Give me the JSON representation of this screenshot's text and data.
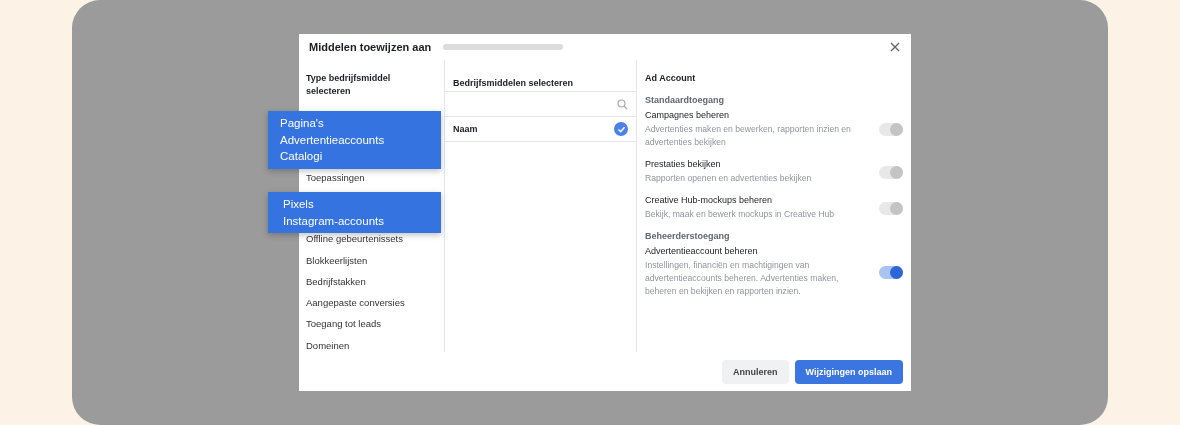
{
  "dialog": {
    "title": "Middelen toewijzen aan",
    "left": {
      "heading": "Type bedrijfsmiddel selecteren",
      "groups": [
        [
          "Toepassingen"
        ],
        [
          "Offline gebeurtenissets",
          "Blokkeerlijsten",
          "Bedrijfstakken",
          "Aangepaste conversies",
          "Toegang tot leads",
          "Domeinen"
        ]
      ]
    },
    "middle": {
      "heading": "Bedrijfsmiddelen selecteren",
      "rows": [
        {
          "label": "Naam",
          "selected": true
        }
      ]
    },
    "right": {
      "heading": "Ad Account",
      "sections": [
        {
          "title": "Standaardtoegang",
          "permissions": [
            {
              "name": "Campagnes beheren",
              "description": "Advertenties maken en bewerken, rapporten inzien en advertenties bekijken",
              "on": true,
              "disabled": true
            },
            {
              "name": "Prestaties bekijken",
              "description": "Rapporten openen en advertenties bekijken",
              "on": true,
              "disabled": true
            },
            {
              "name": "Creative Hub-mockups beheren",
              "description": "Bekijk, maak en bewerk mockups in Creative Hub",
              "on": true,
              "disabled": true
            }
          ]
        },
        {
          "title": "Beheerderstoegang",
          "permissions": [
            {
              "name": "Advertentieaccount beheren",
              "description": "Instellingen, financiën en machtigingen van advertentieaccounts beheren. Advertenties maken, beheren en bekijken en rapporten inzien.",
              "on": true,
              "disabled": false
            }
          ]
        }
      ]
    },
    "buttons": [
      {
        "label": "Annuleren",
        "kind": "secondary"
      },
      {
        "label": "Wijzigingen opslaan",
        "kind": "primary"
      }
    ]
  },
  "callouts": [
    {
      "lines": [
        "Pagina's",
        "Advertentieaccounts",
        "Catalogi"
      ]
    },
    {
      "lines": [
        "Pixels",
        "Instagram-accounts"
      ]
    }
  ]
}
